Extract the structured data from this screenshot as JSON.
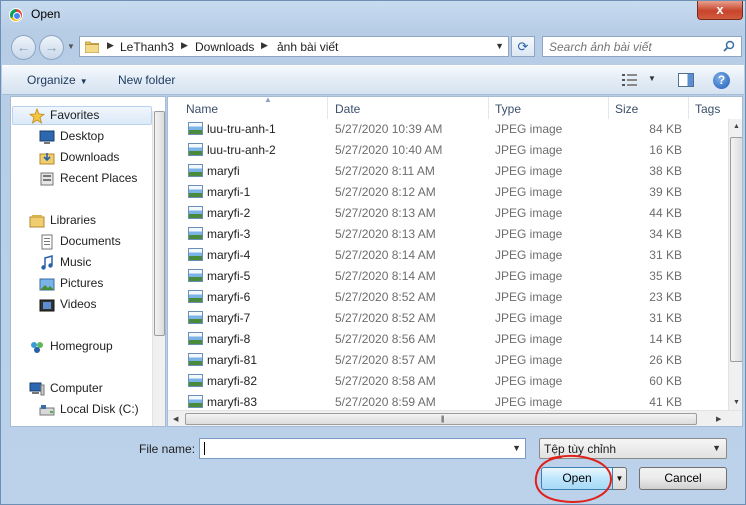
{
  "window": {
    "title": "Open",
    "close_glyph": "x"
  },
  "nav": {
    "back_glyph": "←",
    "forward_glyph": "→"
  },
  "address": {
    "crumbs": [
      "LeThanh3",
      "Downloads",
      "ảnh bài viết"
    ],
    "separator": "▶"
  },
  "search": {
    "placeholder": "Search ảnh bài viết"
  },
  "toolbar": {
    "organize_label": "Organize",
    "new_folder_label": "New folder"
  },
  "sidebar": {
    "favorites": {
      "label": "Favorites",
      "items": [
        "Desktop",
        "Downloads",
        "Recent Places"
      ]
    },
    "libraries": {
      "label": "Libraries",
      "items": [
        "Documents",
        "Music",
        "Pictures",
        "Videos"
      ]
    },
    "homegroup": {
      "label": "Homegroup"
    },
    "computer": {
      "label": "Computer",
      "items": [
        "Local Disk (C:)"
      ]
    }
  },
  "columns": [
    "Name",
    "Date",
    "Type",
    "Size",
    "Tags"
  ],
  "files": [
    {
      "name": "luu-tru-anh-1",
      "date": "5/27/2020 10:39 AM",
      "type": "JPEG image",
      "size": "84 KB"
    },
    {
      "name": "luu-tru-anh-2",
      "date": "5/27/2020 10:40 AM",
      "type": "JPEG image",
      "size": "16 KB"
    },
    {
      "name": "maryfi",
      "date": "5/27/2020 8:11 AM",
      "type": "JPEG image",
      "size": "38 KB"
    },
    {
      "name": "maryfi-1",
      "date": "5/27/2020 8:12 AM",
      "type": "JPEG image",
      "size": "39 KB"
    },
    {
      "name": "maryfi-2",
      "date": "5/27/2020 8:13 AM",
      "type": "JPEG image",
      "size": "44 KB"
    },
    {
      "name": "maryfi-3",
      "date": "5/27/2020 8:13 AM",
      "type": "JPEG image",
      "size": "34 KB"
    },
    {
      "name": "maryfi-4",
      "date": "5/27/2020 8:14 AM",
      "type": "JPEG image",
      "size": "31 KB"
    },
    {
      "name": "maryfi-5",
      "date": "5/27/2020 8:14 AM",
      "type": "JPEG image",
      "size": "35 KB"
    },
    {
      "name": "maryfi-6",
      "date": "5/27/2020 8:52 AM",
      "type": "JPEG image",
      "size": "23 KB"
    },
    {
      "name": "maryfi-7",
      "date": "5/27/2020 8:52 AM",
      "type": "JPEG image",
      "size": "31 KB"
    },
    {
      "name": "maryfi-8",
      "date": "5/27/2020 8:56 AM",
      "type": "JPEG image",
      "size": "14 KB"
    },
    {
      "name": "maryfi-81",
      "date": "5/27/2020 8:57 AM",
      "type": "JPEG image",
      "size": "26 KB"
    },
    {
      "name": "maryfi-82",
      "date": "5/27/2020 8:58 AM",
      "type": "JPEG image",
      "size": "60 KB"
    },
    {
      "name": "maryfi-83",
      "date": "5/27/2020 8:59 AM",
      "type": "JPEG image",
      "size": "41 KB"
    }
  ],
  "bottom": {
    "file_name_label": "File name:",
    "file_name_value": "",
    "filter_value": "Tệp tùy chỉnh",
    "open_label": "Open",
    "cancel_label": "Cancel"
  },
  "colors": {
    "accent": "#3c7fb1",
    "annotation": "#e0201a",
    "titlebar": "#b9d1ea"
  }
}
